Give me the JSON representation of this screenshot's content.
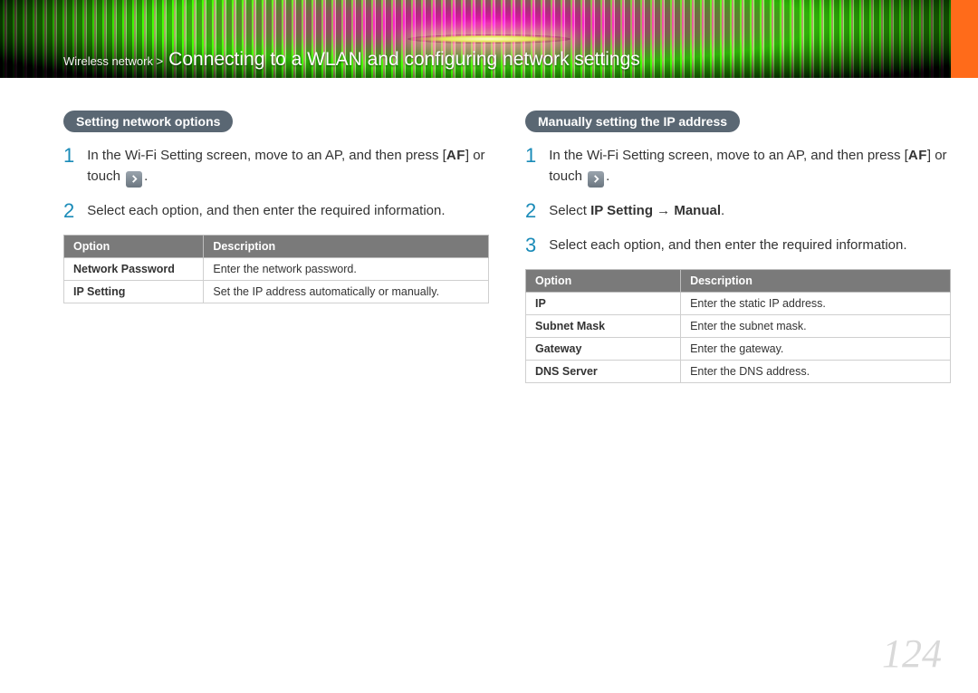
{
  "breadcrumb": {
    "section": "Wireless network >",
    "title": "Connecting to a WLAN and configuring network settings"
  },
  "page_number": "124",
  "icons": {
    "af": "AF"
  },
  "left": {
    "heading": "Setting network options",
    "steps": [
      {
        "num": "1",
        "text_a": "In the Wi-Fi Setting screen, move to an AP, and then press [",
        "text_b": "] or touch ",
        "text_c": "."
      },
      {
        "num": "2",
        "text_a": "Select each option, and then enter the required information."
      }
    ],
    "table": {
      "head": {
        "c1": "Option",
        "c2": "Description"
      },
      "rows": [
        {
          "c1": "Network Password",
          "c2": "Enter the network password."
        },
        {
          "c1": "IP Setting",
          "c2": "Set the IP address automatically or manually."
        }
      ]
    }
  },
  "right": {
    "heading": "Manually setting the IP address",
    "steps": [
      {
        "num": "1",
        "text_a": "In the Wi-Fi Setting screen, move to an AP, and then press [",
        "text_b": "] or touch ",
        "text_c": "."
      },
      {
        "num": "2",
        "prefix": "Select ",
        "bold": "IP Setting → Manual",
        "suffix": "."
      },
      {
        "num": "3",
        "text_a": "Select each option, and then enter the required information."
      }
    ],
    "table": {
      "head": {
        "c1": "Option",
        "c2": "Description"
      },
      "rows": [
        {
          "c1": "IP",
          "c2": "Enter the static IP address."
        },
        {
          "c1": "Subnet Mask",
          "c2": "Enter the subnet mask."
        },
        {
          "c1": "Gateway",
          "c2": "Enter the gateway."
        },
        {
          "c1": "DNS Server",
          "c2": "Enter the DNS address."
        }
      ]
    }
  }
}
